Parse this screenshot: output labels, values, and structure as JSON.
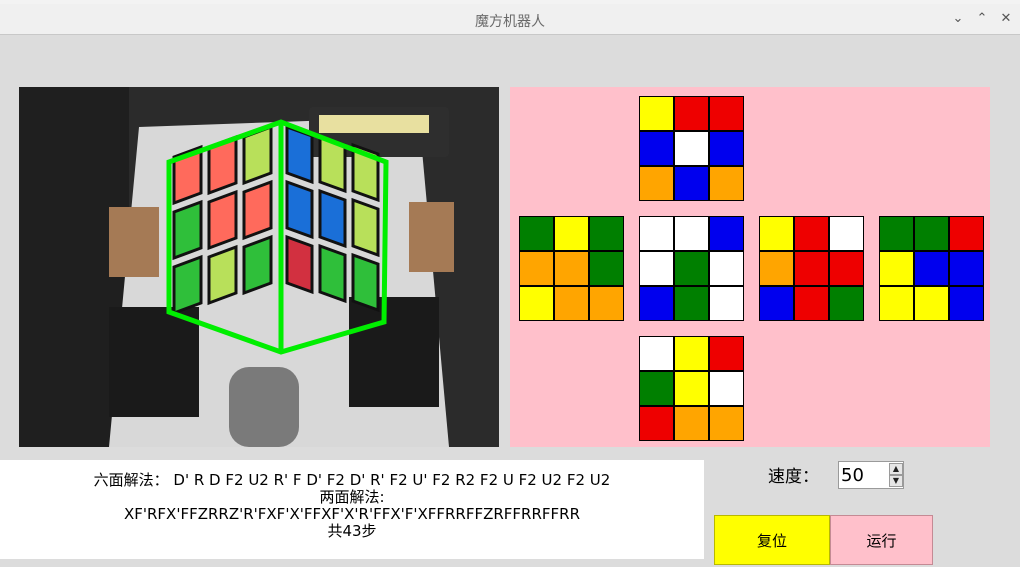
{
  "window": {
    "title": "魔方机器人",
    "minimize_glyph": "⌄",
    "maximize_glyph": "⌃",
    "close_glyph": "✕"
  },
  "colors": {
    "Y": "#ffff00",
    "R": "#ee0000",
    "B": "#0000ee",
    "W": "#ffffff",
    "O": "#ffa500",
    "G": "#007f00",
    "net_background": "#ffc0cb",
    "overlay_outline": "#00ee00"
  },
  "cube_net": {
    "up": [
      "Y",
      "R",
      "R",
      "B",
      "W",
      "B",
      "O",
      "B",
      "O"
    ],
    "left": [
      "G",
      "Y",
      "G",
      "O",
      "O",
      "G",
      "Y",
      "O",
      "O"
    ],
    "front": [
      "W",
      "W",
      "B",
      "W",
      "G",
      "W",
      "B",
      "G",
      "W"
    ],
    "right": [
      "Y",
      "R",
      "W",
      "O",
      "R",
      "R",
      "B",
      "R",
      "G"
    ],
    "back": [
      "G",
      "G",
      "R",
      "Y",
      "B",
      "B",
      "Y",
      "Y",
      "B"
    ],
    "down": [
      "W",
      "Y",
      "R",
      "G",
      "Y",
      "W",
      "R",
      "O",
      "O"
    ]
  },
  "camera": {
    "left_face_colors": [
      "#ff6a5c",
      "#ff6a5c",
      "#b8e05a",
      "#2fbf3a",
      "#ff6a5c",
      "#ff6a5c",
      "#2fbf3a",
      "#b8e05a",
      "#2fbf3a"
    ],
    "right_face_colors": [
      "#1a6fd8",
      "#b8e05a",
      "#b8e05a",
      "#1a6fd8",
      "#1a6fd8",
      "#b8e05a",
      "#d23040",
      "#2fbf3a",
      "#2fbf3a"
    ]
  },
  "solution": {
    "six_face": "六面解法： D' R D F2 U2 R' F D' F2 D' R' F2 U' F2 R2 F2 U F2 U2 F2 U2",
    "two_face_label": "两面解法:",
    "two_face": "XF'RFX'FFZRRZ'R'FXF'X'FFXF'X'R'FFX'F'XFFRRFFZRFFRRFFRR",
    "steps": "共43步"
  },
  "speed": {
    "label": "速度：",
    "value": "50",
    "up_glyph": "▲",
    "down_glyph": "▼"
  },
  "buttons": {
    "reset": "复位",
    "run": "运行"
  }
}
